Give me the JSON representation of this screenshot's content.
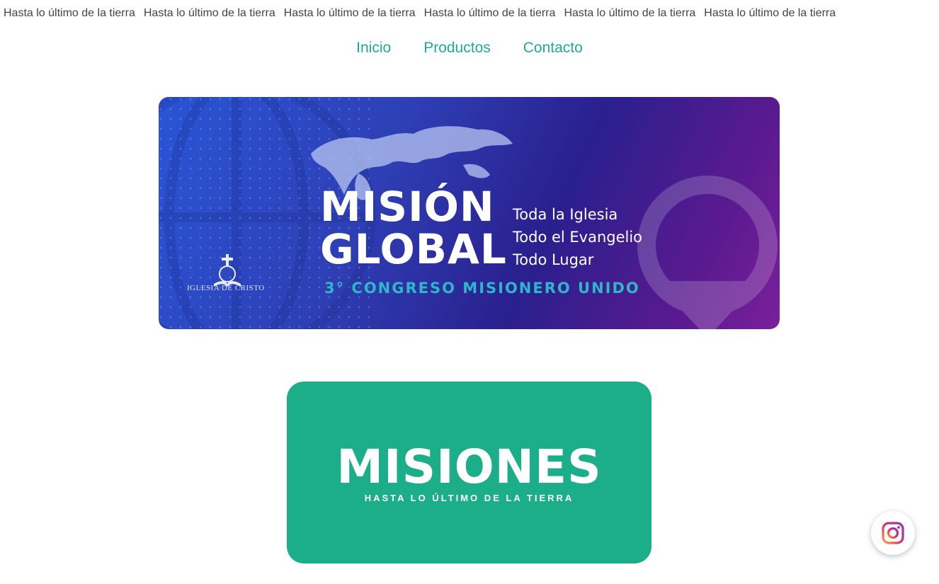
{
  "marquee": {
    "items": [
      "Hasta lo último de la tierra",
      "Hasta lo último de la tierra",
      "Hasta lo último de la tierra",
      "Hasta lo último de la tierra",
      "Hasta lo último de la tierra",
      "Hasta lo último de la tierra"
    ]
  },
  "nav": {
    "items": [
      "Inicio",
      "Productos",
      "Contacto"
    ]
  },
  "banner": {
    "title_line1": "MISIÓN",
    "title_line2": "GLOBAL",
    "tagline": [
      "Toda la Iglesia",
      "Todo el Evangelio",
      "Todo Lugar"
    ],
    "subtitle": "3° CONGRESO MISIONERO UNIDO",
    "org": "IGLESIA DE CRISTO"
  },
  "misiones": {
    "title": "MISIONES",
    "subtitle": "HASTA LO ÚLTIMO DE LA TIERRA"
  },
  "social": {
    "icon": "instagram-icon"
  },
  "colors": {
    "accent": "#21a99a",
    "card_green": "#1cae88",
    "banner_start": "#2a55d6",
    "banner_end": "#7a1f9b"
  }
}
